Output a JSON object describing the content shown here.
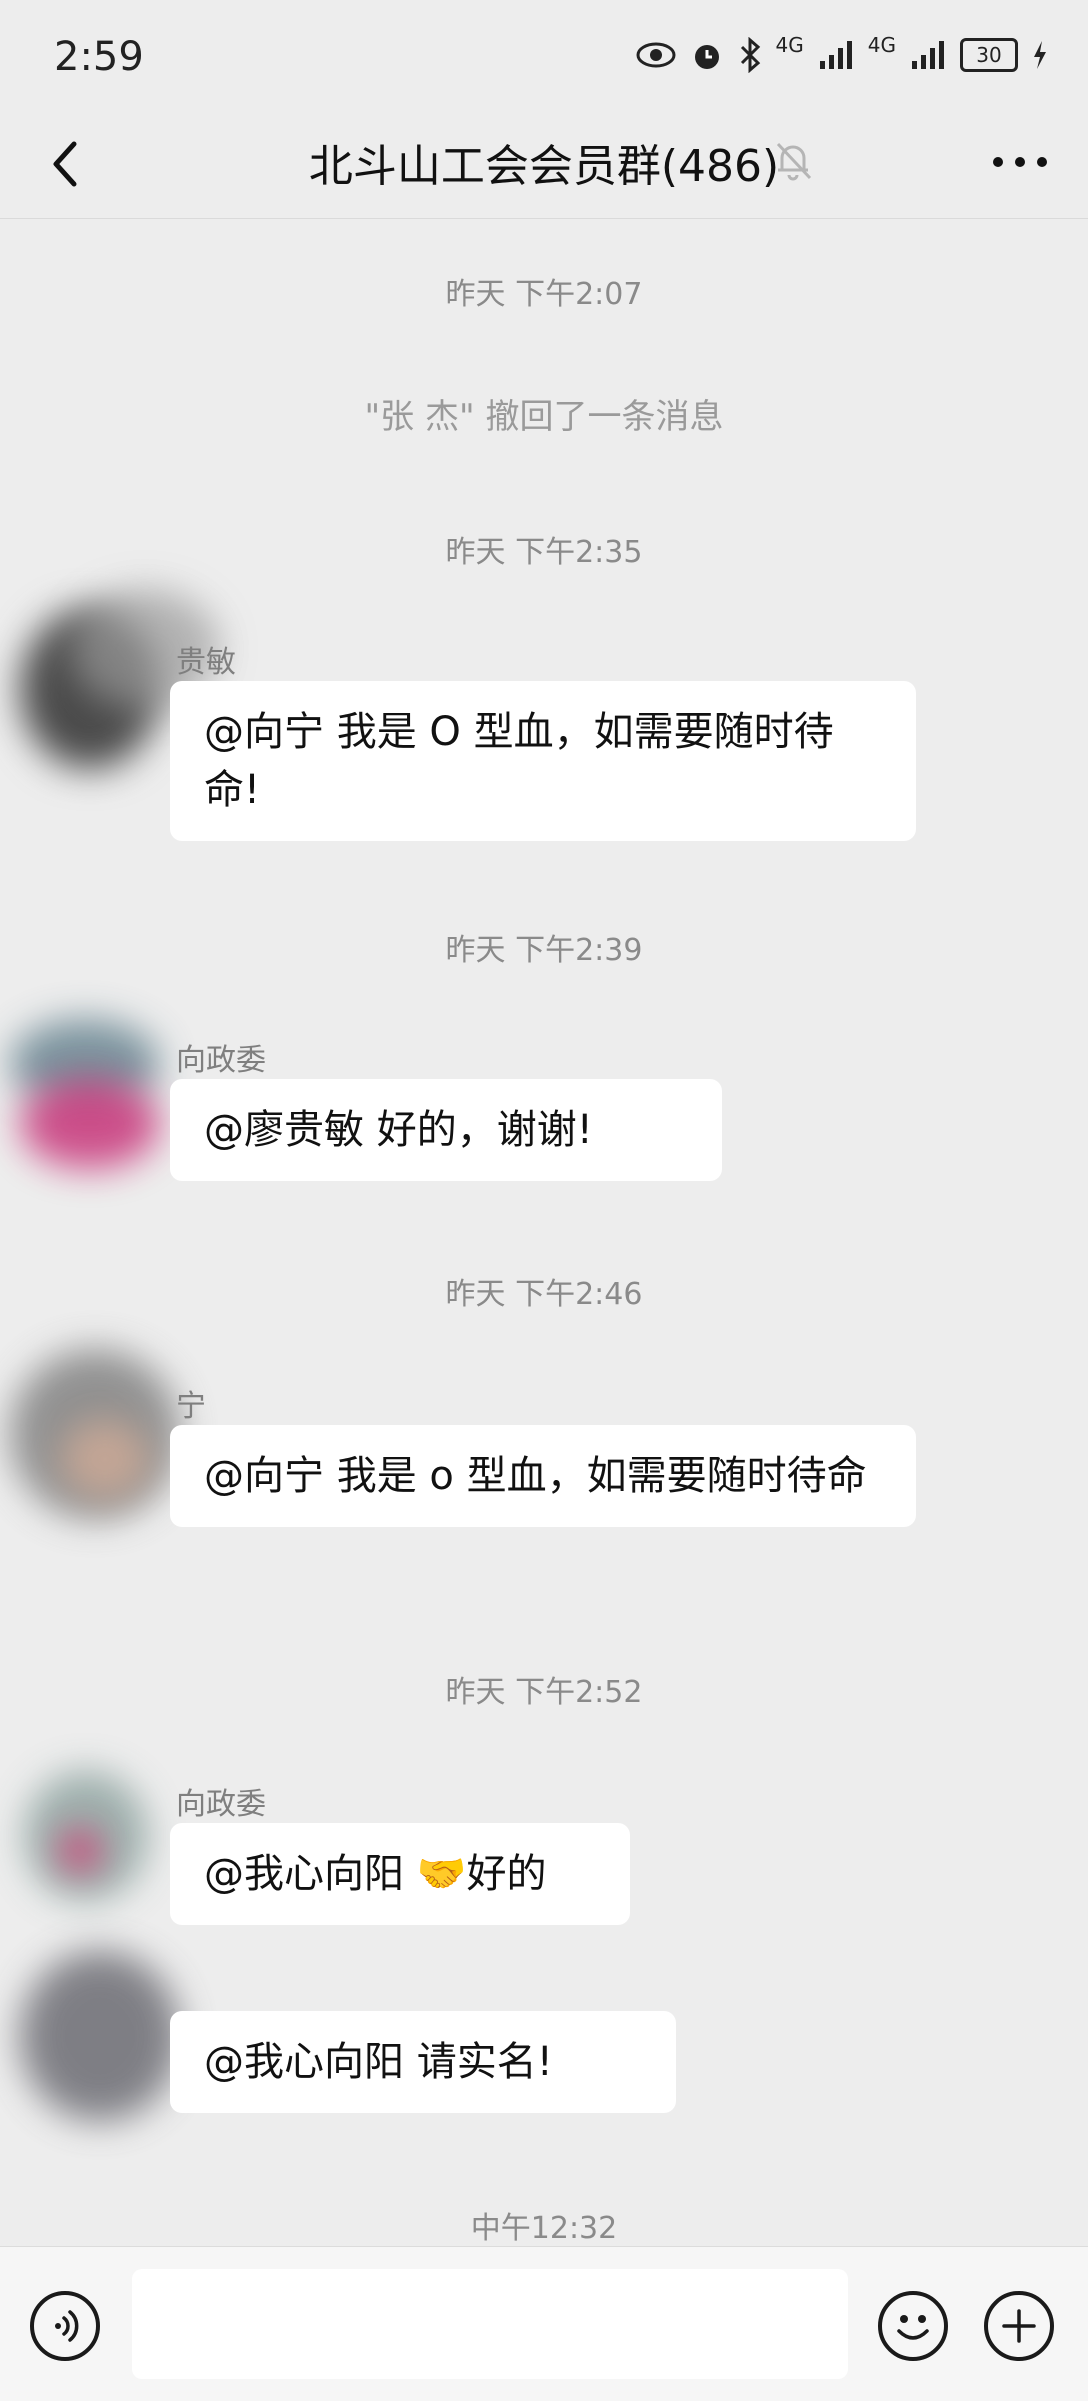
{
  "status_bar": {
    "time": "2:59",
    "signal1": "4G",
    "signal2": "4G",
    "battery": "30"
  },
  "header": {
    "title": "北斗山工会会员群(486)"
  },
  "messages": {
    "ts1": "昨天 下午2:07",
    "recall": "\"张  杰\" 撤回了一条消息",
    "ts2": "昨天 下午2:35",
    "m1_sender": "贵敏",
    "m1_text": "@向宁  我是 O 型血，如需要随时待命!",
    "ts3": "昨天 下午2:39",
    "m2_sender": "向政委",
    "m2_text": "@廖贵敏  好的，谢谢!",
    "ts4": "昨天 下午2:46",
    "m3_sender": "宁",
    "m3_text": "@向宁  我是 o 型血，如需要随时待命",
    "ts5": "昨天 下午2:52",
    "m4_sender": "向政委",
    "m4_text": "@我心向阳 🤝好的",
    "m5_text": "@我心向阳  请实名!",
    "ts6": "中午12:32"
  },
  "input": {
    "value": ""
  }
}
